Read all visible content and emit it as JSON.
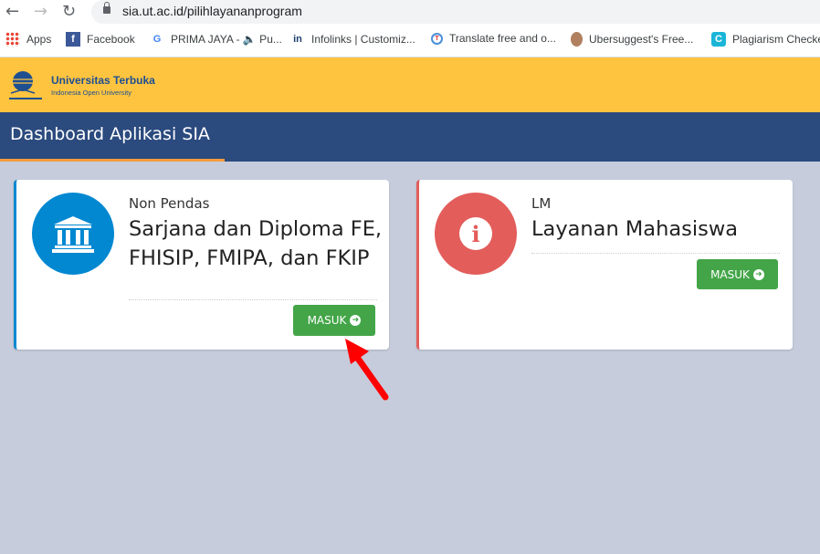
{
  "browser": {
    "url": "sia.ut.ac.id/pilihlayananprogram",
    "bookmarks": [
      {
        "label": "Apps",
        "icon": "apps-grid-icon"
      },
      {
        "label": "Facebook",
        "icon": "facebook-icon"
      },
      {
        "label": "PRIMA JAYA - 🔈 Pu...",
        "icon": "google-icon"
      },
      {
        "label": "Infolinks | Customiz...",
        "icon": "infolinks-icon"
      },
      {
        "label": "Translate free and o...",
        "icon": "translate-icon"
      },
      {
        "label": "Ubersuggest's Free...",
        "icon": "ubersuggest-icon"
      },
      {
        "label": "Plagiarism Checke",
        "icon": "plagiarism-icon"
      }
    ]
  },
  "header": {
    "brand": "Universitas Terbuka",
    "tagline": "Indonesia Open University"
  },
  "nav": {
    "title": "Dashboard Aplikasi SIA"
  },
  "cards": [
    {
      "subtitle": "Non Pendas",
      "title": "Sarjana dan Diploma FE, FHISIP, FMIPA, dan FKIP",
      "button": "MASUK",
      "icon": "university-building-icon",
      "color": "#0288d1"
    },
    {
      "subtitle": "LM",
      "title": "Layanan Mahasiswa",
      "button": "MASUK",
      "icon": "info-icon",
      "color": "#e35d5b"
    }
  ],
  "annotation": {
    "color": "#ff0000"
  }
}
